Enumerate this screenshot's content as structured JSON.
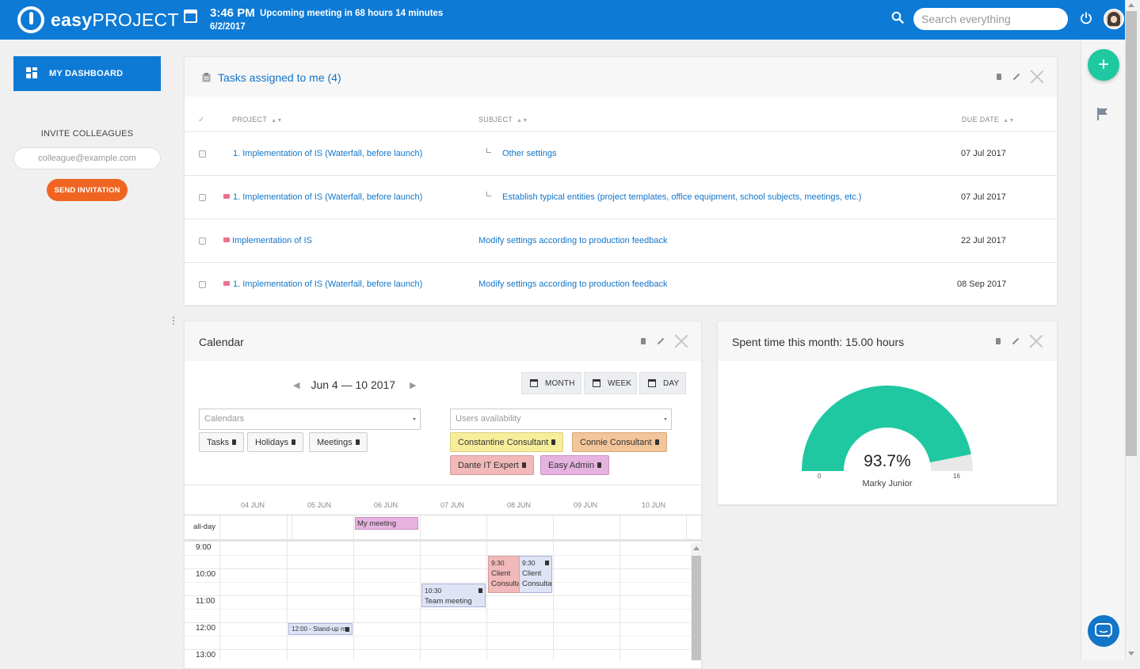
{
  "topbar": {
    "brand_bold": "easy",
    "brand_light": "PROJECT",
    "time": "3:46 PM",
    "meeting_notice": "Upcoming meeting in 68 hours 14 minutes",
    "date": "6/2/2017",
    "search_placeholder": "Search everything",
    "colors": {
      "bar": "#0d7ad6"
    }
  },
  "sidebar": {
    "dashboard_label": "MY DASHBOARD",
    "invite_title": "INVITE COLLEAGUES",
    "invite_placeholder": "colleague@example.com",
    "send_label": "SEND INVITATION",
    "colors": {
      "send": "#f06422"
    }
  },
  "tasks": {
    "title": "Tasks assigned to me (4)",
    "headers": {
      "project": "PROJECT",
      "subject": "SUBJECT",
      "due": "DUE DATE"
    },
    "rows": [
      {
        "project": "1. Implementation of IS (Waterfall, before launch)",
        "subject": "Other settings",
        "due": "07 Jul 2017",
        "mail": false,
        "subtask": true
      },
      {
        "project": "1. Implementation of IS (Waterfall, before launch)",
        "subject": "Establish typical entities (project templates, office equipment, school subjects, meetings, etc.)",
        "due": "07 Jul 2017",
        "mail": true,
        "subtask": true
      },
      {
        "project": "Implementation of IS",
        "subject": "Modify settings according to production feedback",
        "due": "22 Jul 2017",
        "mail": true,
        "subtask": false
      },
      {
        "project": "1. Implementation of IS (Waterfall, before launch)",
        "subject": "Modify settings according to production feedback",
        "due": "08 Sep 2017",
        "mail": true,
        "subtask": false
      }
    ]
  },
  "calendar": {
    "title": "Calendar",
    "range": "Jun 4 — 10 2017",
    "views": [
      "MONTH",
      "WEEK",
      "DAY"
    ],
    "calendars_placeholder": "Calendars",
    "users_placeholder": "Users availability",
    "calendar_chips": [
      "Tasks",
      "Holidays",
      "Meetings"
    ],
    "user_chips": [
      {
        "label": "Constantine Consultant",
        "color": "#f7ee9c"
      },
      {
        "label": "Connie Consultant",
        "color": "#f3c59a"
      },
      {
        "label": "Dante IT Expert",
        "color": "#f1b9b9"
      },
      {
        "label": "Easy Admin",
        "color": "#e6b3e0"
      }
    ],
    "days": [
      "04 JUN",
      "05 JUN",
      "06 JUN",
      "07 JUN",
      "08 JUN",
      "09 JUN",
      "10 JUN"
    ],
    "allday_label": "all-day",
    "hours": [
      "9:00",
      "10:00",
      "11:00",
      "12:00",
      "13:00"
    ],
    "allday_event": "My meeting",
    "events": [
      {
        "time": "9:30",
        "title": "Client Consulta",
        "day": "08 JUN",
        "color": "#f1b9b9"
      },
      {
        "time": "9:30",
        "title": "Client Consulta",
        "day": "08 JUN",
        "color": "#dfe3f6"
      },
      {
        "time": "10:30",
        "title": "Team meeting",
        "day": "07 JUN",
        "color": "#dfe3f6"
      },
      {
        "time": "12:00",
        "title": "12:00 - Stand-up m",
        "day": "05 JUN",
        "color": "#dfe3f6"
      }
    ]
  },
  "spent": {
    "title": "Spent time this month: 15.00 hours",
    "percent_text": "93.7%",
    "percent": 0.937,
    "min": "0",
    "max": "16",
    "user": "Marky Junior",
    "colors": {
      "fill": "#1fc8a0",
      "rest": "#e8e8e8"
    }
  }
}
